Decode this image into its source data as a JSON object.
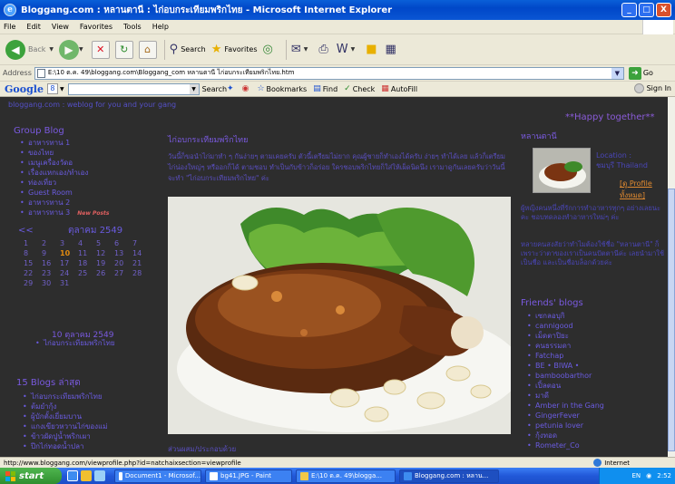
{
  "window": {
    "title": "Bloggang.com : หลานตานี : ไก่อบกระเทียมพริกไทย - Microsoft Internet Explorer",
    "buttons": {
      "minimize": "_",
      "maximize": "□",
      "close": "X"
    }
  },
  "menubar": [
    "File",
    "Edit",
    "View",
    "Favorites",
    "Tools",
    "Help"
  ],
  "toolbar": {
    "back": "Back",
    "search": "Search",
    "favorites": "Favorites"
  },
  "addressbar": {
    "label": "Address",
    "url": "E:\\10 ต.ค. 49\\bloggang.com\\Bloggang_com  หลานตานี  ไก่อบกระเทียมพริกไทย.htm",
    "go": "Go"
  },
  "googlebar": {
    "logo": "Google",
    "logo_g": "8",
    "search": "Search",
    "bookmarks": "Bookmarks",
    "find": "Find",
    "check": "Check",
    "autofill": "AutoFill",
    "signin": "Sign In"
  },
  "page": {
    "tagline": "bloggang.com : weblog for you and your gang",
    "happy": "**Happy together**",
    "group_title": "Group Blog",
    "group_items": [
      "อาหารทาน 1",
      "ของไทย",
      "เมนูเครื่องวัดอ",
      "เรื่องแหกเอง/ทำเอง",
      "ท่องเที่ยว",
      "Guest Room",
      "อาหารทาน 2",
      "อาหารทาน 3"
    ],
    "group_new_badge": "New Posts",
    "calendar": {
      "prev": "<<",
      "month": "ตุลาคม 2549",
      "days": [
        "1",
        "2",
        "3",
        "4",
        "5",
        "6",
        "7",
        "8",
        "9",
        "10",
        "11",
        "12",
        "13",
        "14",
        "15",
        "16",
        "17",
        "18",
        "19",
        "20",
        "21",
        "22",
        "23",
        "24",
        "25",
        "26",
        "27",
        "28",
        "29",
        "30",
        "31"
      ],
      "highlight": "10"
    },
    "day_title": "10 ตุลาคม 2549",
    "day_entries": [
      "ไก่อบกระเทียมพริกไทย"
    ],
    "recent_title": "15 Blogs ล่าสุด",
    "recent_items": [
      "ไก่อบกระเทียมพริกไทย",
      "ต้มยำกุ้ง",
      "ผู้บักตั้งเยี่ยมบาน",
      "แกงเขียวหวานไก่ของแม่",
      "ข้าวผัดปูน้ำพริกเผา",
      "ปีกไก่ทอดน้ำปลา"
    ],
    "post_title": "ไก่อบกระเทียมพริกไทย",
    "post_body": "วันนี้ก็ขอนำไก่มาทำ ๆ กันง่ายๆ ตามเคยครับ ตัวนี้เตรียมไม่ยาก คุณผู้ชายก็ทำเองได้ครับ ง่ายๆ ทำได้เลย แล้วก็เตรียมไก่น่องใหญ่ๆ หรืออกก็ได้ ตามชอบ ทำเป็นกับข้าวก็อร่อย ใครชอบพริกไทยก็ใส่ให้เผ็ดนิดนึง เรามาดูกันเลยครับว่าวันนี้จะทำ \"ไก่อบกระเทียมพริกไทย\" ค่ะ",
    "post_footer": "ส่วนผสม/ประกอบด้วย",
    "profile_name": "หลานตานี",
    "location_label": "Location :",
    "location_value": "ชมบุรี Thailand",
    "profile_link": "[ดู Profile ทั้งหมด]",
    "about": "ผู้หญิงคนหนึ่งที่รักการทำอาหารทุกๆ อย่างเลยนะคะ ชอบทดลองทำอาหารใหม่ๆ ค่ะ",
    "about2": "หลายคนสงสัยว่าทำไมต้องใช้ชื่อ \"หลานตานี\" ก็เพราะว่าตาของเราเป็นคนปัตตานีค่ะ เลยนำมาใช้เป็นชื่อ และเป็นชื่อบล็อกด้วยค่ะ",
    "friends_title": "Friends' blogs",
    "friends": [
      "เซกลอบุกิ",
      "cannigood",
      "เม็ดตาปิยะ",
      "คนธรรมดา",
      "Fatchap",
      "BE • BIWA •",
      "bamboobarthor",
      "เปิ้ลตอน",
      "มาดี",
      "Amber in the Gang",
      "GingerFever",
      "petunia lover",
      "กุ้งทอด",
      "Rometer_Co"
    ]
  },
  "statusbar": {
    "url": "http://www.bloggang.com/viewprofile.php?id=natchaixsection=viewprofile",
    "zone": "Internet"
  },
  "taskbar": {
    "start": "start",
    "tasks": [
      "Document1 - Microsof...",
      "bg41.JPG - Paint",
      "E:\\10 ต.ค. 49\\blogga...",
      "Bloggang.com : หลาน..."
    ],
    "lang": "EN",
    "time": "2:52"
  },
  "colors": {
    "page_bg": "#2d2d2d",
    "link": "#6a5be0",
    "accent_orange": "#e08a10",
    "titlebar": "#0047c8"
  }
}
